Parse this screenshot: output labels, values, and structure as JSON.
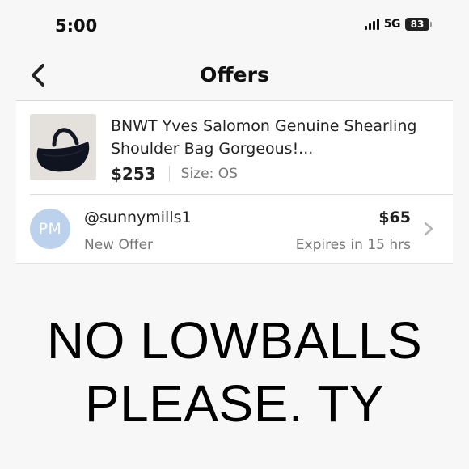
{
  "status_bar": {
    "time": "5:00",
    "network": "5G",
    "battery": "83"
  },
  "header": {
    "title": "Offers",
    "back_icon": "chevron-left-icon"
  },
  "listing": {
    "title": "BNWT Yves Salomon Genuine Shearling Shoulder Bag Gorgeous!...",
    "price": "$253",
    "size": "Size: OS"
  },
  "offer": {
    "avatar_initials": "PM",
    "username": "@sunnymills1",
    "status": "New Offer",
    "amount": "$65",
    "expiry": "Expires in 15 hrs",
    "chevron_icon": "chevron-right-icon"
  },
  "overlay": {
    "line1": "NO LOWBALLS",
    "line2": "PLEASE. TY"
  },
  "colors": {
    "background": "#f7f7f7",
    "panel": "#ffffff",
    "avatar": "#bcd1ec",
    "muted_text": "#777777"
  }
}
